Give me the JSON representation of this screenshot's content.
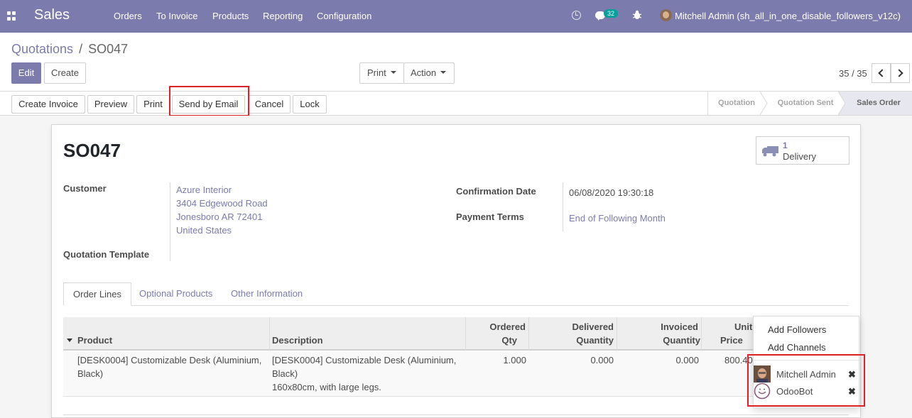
{
  "navbar": {
    "app_name": "Sales",
    "menu": [
      "Orders",
      "To Invoice",
      "Products",
      "Reporting",
      "Configuration"
    ],
    "chat_count": "32",
    "user": "Mitchell Admin (sh_all_in_one_disable_followers_v12c)"
  },
  "breadcrumb": {
    "parent": "Quotations",
    "separator": "/",
    "current": "SO047"
  },
  "control": {
    "edit_label": "Edit",
    "create_label": "Create",
    "print_label": "Print",
    "action_label": "Action",
    "pager": "35 / 35"
  },
  "statusbar": {
    "buttons": [
      "Create Invoice",
      "Preview",
      "Print",
      "Send by Email",
      "Cancel",
      "Lock"
    ],
    "stages": [
      "Quotation",
      "Quotation Sent",
      "Sales Order"
    ],
    "active_stage": "Sales Order"
  },
  "sheet": {
    "name": "SO047",
    "smart_button": {
      "count": "1",
      "label": "Delivery"
    },
    "customer_label": "Customer",
    "customer_lines": [
      "Azure Interior",
      "3404 Edgewood Road",
      "Jonesboro AR 72401",
      "United States"
    ],
    "template_label": "Quotation Template",
    "confirmation_label": "Confirmation Date",
    "confirmation_value": "06/08/2020 19:30:18",
    "payment_label": "Payment Terms",
    "payment_value": "End of Following Month"
  },
  "tabs": [
    "Order Lines",
    "Optional Products",
    "Other Information"
  ],
  "table": {
    "headers": {
      "product": "Product",
      "description": "Description",
      "ordered_1": "Ordered",
      "ordered_2": "Qty",
      "delivered_1": "Delivered",
      "delivered_2": "Quantity",
      "invoiced_1": "Invoiced",
      "invoiced_2": "Quantity",
      "unit_1": "Unit",
      "unit_2": "Price"
    },
    "row": {
      "product_1": "[DESK0004] Customizable Desk (Aluminium,",
      "product_2": "Black)",
      "desc_1": "[DESK0004] Customizable Desk (Aluminium,",
      "desc_2": "Black)",
      "desc_3": "160x80cm, with large legs.",
      "ordered": "1.000",
      "delivered": "0.000",
      "invoiced": "0.000",
      "unit_price": "800.40"
    }
  },
  "followers_menu": {
    "add_followers": "Add Followers",
    "add_channels": "Add Channels",
    "followers": [
      "Mitchell Admin",
      "OdooBot"
    ],
    "remove_glyph": "✖"
  },
  "colors": {
    "brand": "#7c7bad",
    "highlight": "#e0202b"
  }
}
